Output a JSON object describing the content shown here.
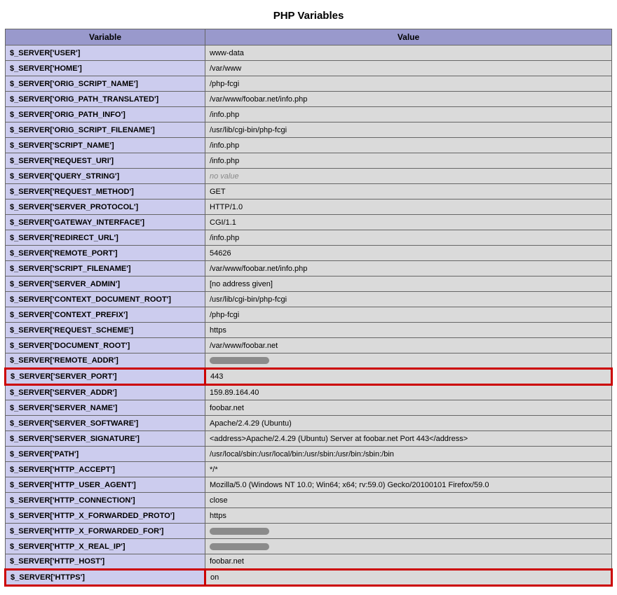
{
  "title": "PHP Variables",
  "headers": {
    "variable": "Variable",
    "value": "Value"
  },
  "no_value_label": "no value",
  "rows": [
    {
      "name": "$_SERVER['USER']",
      "value": "www-data"
    },
    {
      "name": "$_SERVER['HOME']",
      "value": "/var/www"
    },
    {
      "name": "$_SERVER['ORIG_SCRIPT_NAME']",
      "value": "/php-fcgi"
    },
    {
      "name": "$_SERVER['ORIG_PATH_TRANSLATED']",
      "value": "/var/www/foobar.net/info.php"
    },
    {
      "name": "$_SERVER['ORIG_PATH_INFO']",
      "value": "/info.php"
    },
    {
      "name": "$_SERVER['ORIG_SCRIPT_FILENAME']",
      "value": "/usr/lib/cgi-bin/php-fcgi"
    },
    {
      "name": "$_SERVER['SCRIPT_NAME']",
      "value": "/info.php"
    },
    {
      "name": "$_SERVER['REQUEST_URI']",
      "value": "/info.php"
    },
    {
      "name": "$_SERVER['QUERY_STRING']",
      "value": "",
      "empty": true
    },
    {
      "name": "$_SERVER['REQUEST_METHOD']",
      "value": "GET"
    },
    {
      "name": "$_SERVER['SERVER_PROTOCOL']",
      "value": "HTTP/1.0"
    },
    {
      "name": "$_SERVER['GATEWAY_INTERFACE']",
      "value": "CGI/1.1"
    },
    {
      "name": "$_SERVER['REDIRECT_URL']",
      "value": "/info.php"
    },
    {
      "name": "$_SERVER['REMOTE_PORT']",
      "value": "54626"
    },
    {
      "name": "$_SERVER['SCRIPT_FILENAME']",
      "value": "/var/www/foobar.net/info.php"
    },
    {
      "name": "$_SERVER['SERVER_ADMIN']",
      "value": "[no address given]"
    },
    {
      "name": "$_SERVER['CONTEXT_DOCUMENT_ROOT']",
      "value": "/usr/lib/cgi-bin/php-fcgi"
    },
    {
      "name": "$_SERVER['CONTEXT_PREFIX']",
      "value": "/php-fcgi"
    },
    {
      "name": "$_SERVER['REQUEST_SCHEME']",
      "value": "https"
    },
    {
      "name": "$_SERVER['DOCUMENT_ROOT']",
      "value": "/var/www/foobar.net"
    },
    {
      "name": "$_SERVER['REMOTE_ADDR']",
      "value": "",
      "redacted": true
    },
    {
      "name": "$_SERVER['SERVER_PORT']",
      "value": "443",
      "highlight": true
    },
    {
      "name": "$_SERVER['SERVER_ADDR']",
      "value": "159.89.164.40"
    },
    {
      "name": "$_SERVER['SERVER_NAME']",
      "value": "foobar.net"
    },
    {
      "name": "$_SERVER['SERVER_SOFTWARE']",
      "value": "Apache/2.4.29 (Ubuntu)"
    },
    {
      "name": "$_SERVER['SERVER_SIGNATURE']",
      "value": "<address>Apache/2.4.29 (Ubuntu) Server at foobar.net Port 443</address>"
    },
    {
      "name": "$_SERVER['PATH']",
      "value": "/usr/local/sbin:/usr/local/bin:/usr/sbin:/usr/bin:/sbin:/bin"
    },
    {
      "name": "$_SERVER['HTTP_ACCEPT']",
      "value": "*/*"
    },
    {
      "name": "$_SERVER['HTTP_USER_AGENT']",
      "value": "Mozilla/5.0 (Windows NT 10.0; Win64; x64; rv:59.0) Gecko/20100101 Firefox/59.0"
    },
    {
      "name": "$_SERVER['HTTP_CONNECTION']",
      "value": "close"
    },
    {
      "name": "$_SERVER['HTTP_X_FORWARDED_PROTO']",
      "value": "https"
    },
    {
      "name": "$_SERVER['HTTP_X_FORWARDED_FOR']",
      "value": "",
      "redacted": true
    },
    {
      "name": "$_SERVER['HTTP_X_REAL_IP']",
      "value": "",
      "redacted": true
    },
    {
      "name": "$_SERVER['HTTP_HOST']",
      "value": "foobar.net"
    },
    {
      "name": "$_SERVER['HTTPS']",
      "value": "on",
      "highlight": true
    }
  ]
}
